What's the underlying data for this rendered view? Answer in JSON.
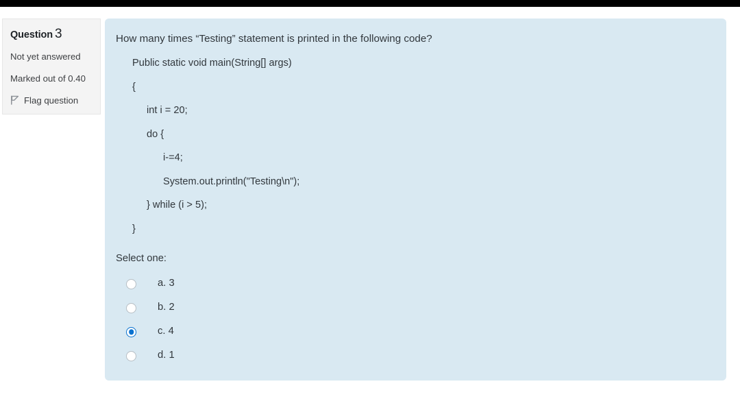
{
  "question_info": {
    "heading_label": "Question",
    "number": "3",
    "state": "Not yet answered",
    "marks": "Marked out of 0.40",
    "flag_label": "Flag question",
    "flag_icon": "flag-icon"
  },
  "question": {
    "text": "How many times “Testing” statement is printed in the following code?",
    "code_lines": [
      {
        "indent": 1,
        "text": "Public static void main(String[] args)"
      },
      {
        "indent": 1,
        "text": "{"
      },
      {
        "indent": 2,
        "text": "int i = 20;"
      },
      {
        "indent": 2,
        "text": "do {"
      },
      {
        "indent": 3,
        "text": "i-=4;"
      },
      {
        "indent": 3,
        "text": "System.out.println(\"Testing\\n\");"
      },
      {
        "indent": 2,
        "text": "} while (i > 5);"
      },
      {
        "indent": 1,
        "text": "}"
      }
    ],
    "select_prompt": "Select one:",
    "answers": [
      {
        "label": "a. 3",
        "selected": false
      },
      {
        "label": "b. 2",
        "selected": false
      },
      {
        "label": "c. 4",
        "selected": true
      },
      {
        "label": "d. 1",
        "selected": false
      }
    ]
  },
  "colors": {
    "panel_background": "#d9e9f2",
    "info_background": "#f4f4f4",
    "accent": "#0b72cf",
    "text": "#31373c",
    "top_bar": "#000000"
  }
}
